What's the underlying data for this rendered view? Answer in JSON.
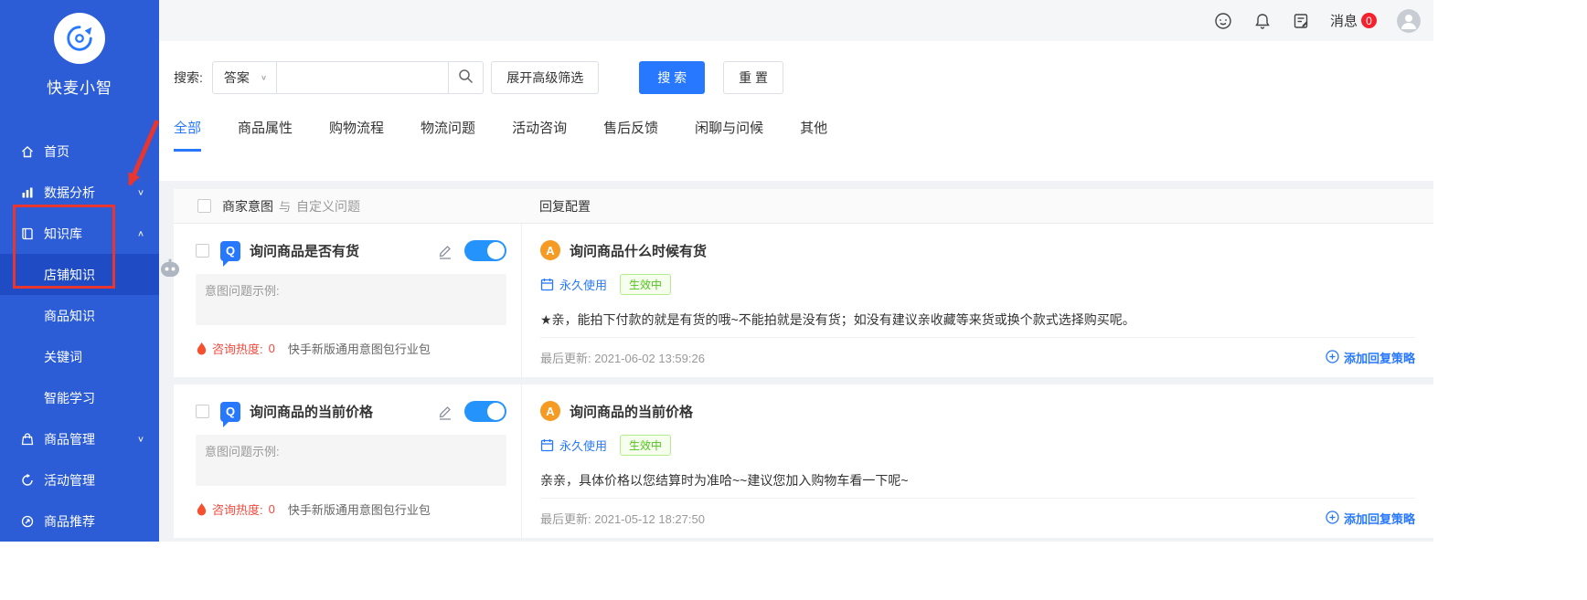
{
  "icons": {
    "chevron_down": "∨",
    "chevron_up": "∧",
    "q_badge": "Q",
    "a_badge": "A"
  },
  "colors": {
    "sidebar_blue": "#2c5dd6",
    "accent_blue": "#2878ff",
    "annotation_red": "#e8352e",
    "badge_red": "#f5222d",
    "status_green": "#52c41a",
    "heat_red": "#f5483b"
  },
  "sidebar": {
    "logo_text": "快麦小智",
    "items": [
      {
        "label": "首页"
      },
      {
        "label": "数据分析"
      },
      {
        "label": "知识库"
      },
      {
        "label": "店铺知识"
      },
      {
        "label": "商品知识"
      },
      {
        "label": "关键词"
      },
      {
        "label": "智能学习"
      },
      {
        "label": "商品管理"
      },
      {
        "label": "活动管理"
      },
      {
        "label": "商品推荐"
      }
    ]
  },
  "topbar": {
    "message_label": "消息",
    "message_count": "0"
  },
  "search": {
    "label": "搜索:",
    "field_select": "答案",
    "input_value": "",
    "expand_button": "展开高级筛选",
    "search_button": "搜 索",
    "reset_button": "重 置"
  },
  "tabs": [
    {
      "label": "全部",
      "active": true
    },
    {
      "label": "商品属性"
    },
    {
      "label": "购物流程"
    },
    {
      "label": "物流问题"
    },
    {
      "label": "活动咨询"
    },
    {
      "label": "售后反馈"
    },
    {
      "label": "闲聊与问候"
    },
    {
      "label": "其他"
    }
  ],
  "list": {
    "header": {
      "intent": "商家意图",
      "sep": "与",
      "custom": "自定义问题",
      "reply": "回复配置"
    },
    "rows": [
      {
        "intent": {
          "title": "询问商品是否有货",
          "example_label": "意图问题示例:",
          "heat_label": "咨询热度:",
          "heat_value": "0",
          "package": "快手新版通用意图包行业包",
          "toggle_on": true
        },
        "reply": {
          "title": "询问商品什么时候有货",
          "duration": "永久使用",
          "status": "生效中",
          "content": "★亲，能拍下付款的就是有货的哦~不能拍就是没有货；如没有建议亲收藏等来货或换个款式选择购买呢。",
          "updated_label": "最后更新:",
          "updated_time": "2021-06-02 13:59:26",
          "add_strategy": "添加回复策略"
        }
      },
      {
        "intent": {
          "title": "询问商品的当前价格",
          "example_label": "意图问题示例:",
          "heat_label": "咨询热度:",
          "heat_value": "0",
          "package": "快手新版通用意图包行业包",
          "toggle_on": true
        },
        "reply": {
          "title": "询问商品的当前价格",
          "duration": "永久使用",
          "status": "生效中",
          "content": "亲亲，具体价格以您结算时为准哈~~建议您加入购物车看一下呢~",
          "updated_label": "最后更新:",
          "updated_time": "2021-05-12 18:27:50",
          "add_strategy": "添加回复策略"
        }
      }
    ]
  }
}
